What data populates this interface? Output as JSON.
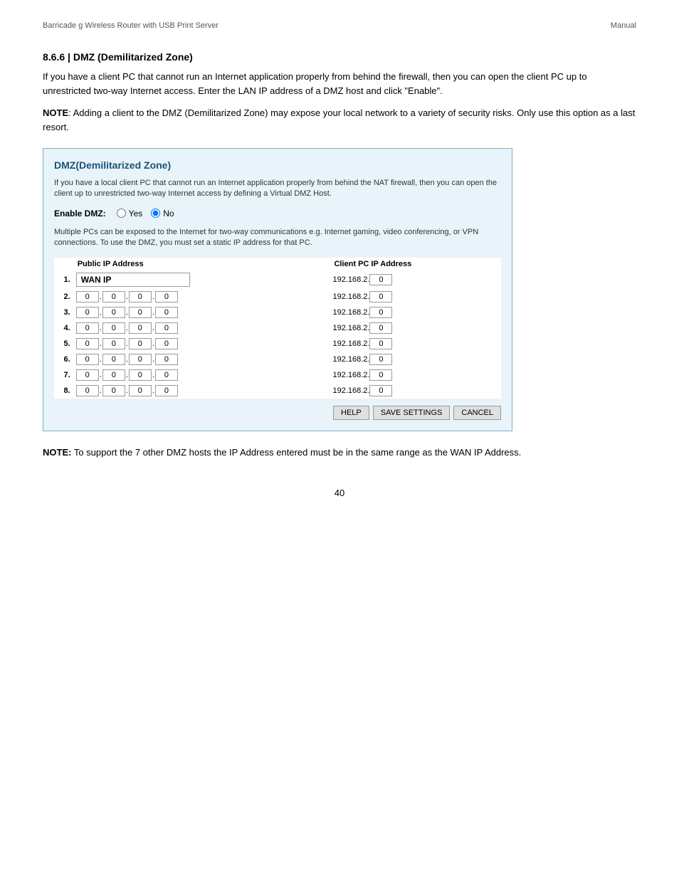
{
  "header": {
    "left": "Barricade g Wireless Router with USB Print Server",
    "right": "Manual"
  },
  "section": {
    "title": "8.6.6 | DMZ (Demilitarized Zone)",
    "body1": "If you have a client PC that cannot run an Internet application properly from behind the firewall, then you can open the client PC up to unrestricted two-way Internet access. Enter the LAN IP address of a DMZ host and click \"Enable\".",
    "note1_bold": "NOTE",
    "note1_rest": ": Adding a client to the DMZ (Demilitarized Zone) may expose your local network to a variety of security risks. Only use this option as a last resort."
  },
  "dmz_box": {
    "title": "DMZ(Demilitarized Zone)",
    "desc": "If you have a local client PC that cannot run an Internet application properly from behind the NAT firewall, then you can open the client up to unrestricted two-way Internet access by defining a Virtual DMZ Host.",
    "enable_label": "Enable DMZ:",
    "yes_label": "Yes",
    "no_label": "No",
    "multi_note": "Multiple PCs can be exposed to the Internet for two-way communications e.g. Internet gaming, video conferencing, or VPN connections.  To use the DMZ, you must set a static IP address for that PC.",
    "col_public": "Public IP Address",
    "col_client": "Client PC IP Address",
    "rows": [
      {
        "num": "1.",
        "is_wan": true,
        "wan_text": "WAN IP",
        "p1": "",
        "p2": "",
        "p3": "",
        "p4": "",
        "client_suffix": "0"
      },
      {
        "num": "2.",
        "is_wan": false,
        "p1": "0",
        "p2": "0",
        "p3": "0",
        "p4": "0",
        "client_suffix": "0"
      },
      {
        "num": "3.",
        "is_wan": false,
        "p1": "0",
        "p2": "0",
        "p3": "0",
        "p4": "0",
        "client_suffix": "0"
      },
      {
        "num": "4.",
        "is_wan": false,
        "p1": "0",
        "p2": "0",
        "p3": "0",
        "p4": "0",
        "client_suffix": "0"
      },
      {
        "num": "5.",
        "is_wan": false,
        "p1": "0",
        "p2": "0",
        "p3": "0",
        "p4": "0",
        "client_suffix": "0"
      },
      {
        "num": "6.",
        "is_wan": false,
        "p1": "0",
        "p2": "0",
        "p3": "0",
        "p4": "0",
        "client_suffix": "0"
      },
      {
        "num": "7.",
        "is_wan": false,
        "p1": "0",
        "p2": "0",
        "p3": "0",
        "p4": "0",
        "client_suffix": "0"
      },
      {
        "num": "8.",
        "is_wan": false,
        "p1": "0",
        "p2": "0",
        "p3": "0",
        "p4": "0",
        "client_suffix": "0"
      }
    ],
    "client_prefix": "192.168.2.",
    "btn_help": "HELP",
    "btn_save": "SAVE SETTINGS",
    "btn_cancel": "CANCEL"
  },
  "note2": {
    "bold": "NOTE:",
    "rest": " To support the 7 other DMZ hosts the IP Address entered must be in the same range as the WAN IP Address."
  },
  "footer": {
    "page_num": "40"
  }
}
